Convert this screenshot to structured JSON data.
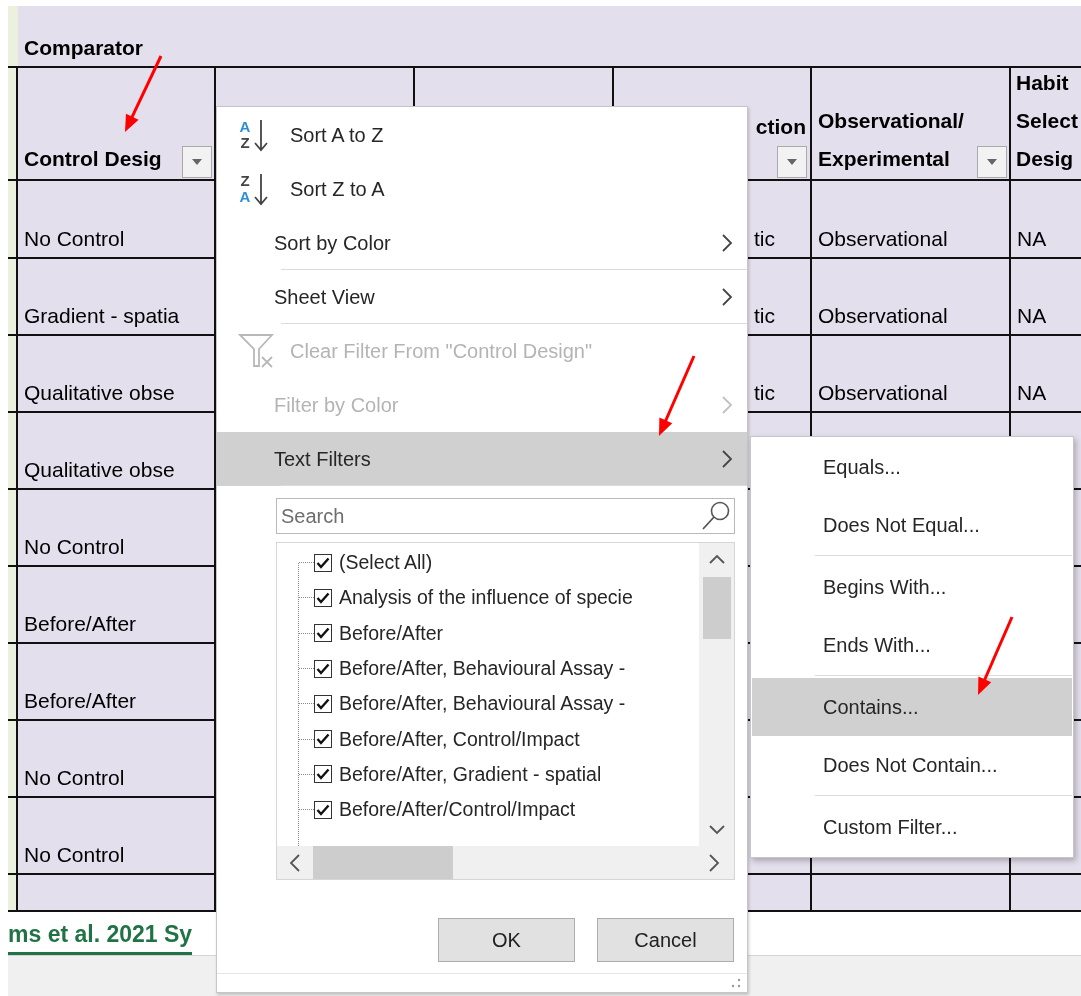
{
  "sheet": {
    "title": "Comparator",
    "columns": [
      {
        "header": "Control Desig",
        "filter_button": true
      },
      {
        "header": "ction",
        "filter_button": true
      },
      {
        "header": "Observational/ Experimental",
        "filter_button": true
      },
      {
        "header": "Habit Select Desig",
        "filter_button": false
      }
    ],
    "rows": [
      {
        "cells": [
          "No Control",
          "tic",
          "Observational",
          "NA"
        ]
      },
      {
        "cells": [
          "Gradient - spatia",
          "tic",
          "Observational",
          "NA"
        ]
      },
      {
        "cells": [
          "Qualitative obse",
          "tic",
          "Observational",
          "NA"
        ]
      },
      {
        "cells": [
          "Qualitative obse"
        ]
      },
      {
        "cells": [
          "No Control"
        ]
      },
      {
        "cells": [
          "Before/After"
        ]
      },
      {
        "cells": [
          "Before/After"
        ]
      },
      {
        "cells": [
          "No Control"
        ]
      },
      {
        "cells": [
          "No Control"
        ]
      }
    ]
  },
  "sheet_tabs": [
    {
      "label": "ms et al. 2021 Sy",
      "selected": true
    }
  ],
  "filter_menu": {
    "items": [
      {
        "kind": "sort",
        "icon_letters": [
          {
            "text": "A",
            "accent": true
          },
          {
            "text": "Z",
            "accent": false
          }
        ],
        "label": "Sort A to Z",
        "disabled": false,
        "selected": false,
        "separator_after": false
      },
      {
        "kind": "sort",
        "icon_letters": [
          {
            "text": "Z",
            "accent": false
          },
          {
            "text": "A",
            "accent": true
          }
        ],
        "label": "Sort Z to A",
        "disabled": false,
        "selected": false,
        "separator_after": false
      },
      {
        "kind": "submenu",
        "label": "Sort by Color",
        "disabled": false,
        "selected": false,
        "separator_after": true
      },
      {
        "kind": "submenu",
        "label": "Sheet View",
        "disabled": false,
        "selected": false,
        "separator_after": true
      },
      {
        "kind": "clear_filter",
        "label": "Clear Filter From \"Control Design\"",
        "disabled": true,
        "selected": false,
        "separator_after": false
      },
      {
        "kind": "submenu",
        "label": "Filter by Color",
        "disabled": true,
        "selected": false,
        "separator_after": false
      },
      {
        "kind": "submenu",
        "label": "Text Filters",
        "disabled": false,
        "selected": true,
        "separator_after": true
      }
    ],
    "search": {
      "placeholder": "Search"
    },
    "values": [
      {
        "label": "(Select All)",
        "checked": true
      },
      {
        "label": "Analysis of the influence of specie",
        "checked": true
      },
      {
        "label": "Before/After",
        "checked": true
      },
      {
        "label": "Before/After, Behavioural Assay -",
        "checked": true
      },
      {
        "label": "Before/After, Behavioural Assay -",
        "checked": true
      },
      {
        "label": "Before/After, Control/Impact",
        "checked": true
      },
      {
        "label": "Before/After, Gradient - spatial",
        "checked": true
      },
      {
        "label": "Before/After/Control/Impact",
        "checked": true
      }
    ],
    "buttons": [
      {
        "label": "OK"
      },
      {
        "label": "Cancel"
      }
    ]
  },
  "text_filters_menu": {
    "items": [
      {
        "label": "Equals...",
        "selected": false,
        "separator_after": false
      },
      {
        "label": "Does Not Equal...",
        "selected": false,
        "separator_after": true
      },
      {
        "label": "Begins With...",
        "selected": false,
        "separator_after": false
      },
      {
        "label": "Ends With...",
        "selected": false,
        "separator_after": true
      },
      {
        "label": "Contains...",
        "selected": true,
        "separator_after": false
      },
      {
        "label": "Does Not Contain...",
        "selected": false,
        "separator_after": true
      },
      {
        "label": "Custom Filter...",
        "selected": false,
        "separator_after": false
      }
    ]
  },
  "annotations": [
    {
      "kind": "arrow"
    },
    {
      "kind": "arrow"
    },
    {
      "kind": "arrow"
    }
  ]
}
